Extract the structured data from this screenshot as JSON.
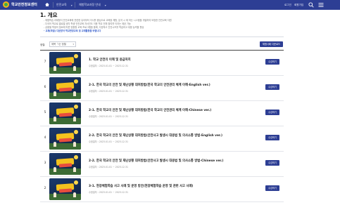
{
  "header": {
    "logo_text": "학교안전정보센터",
    "nav_1": "안전교육",
    "nav_2": "체험학교과정 안내",
    "util_1": "로그인",
    "util_2": "회원가입",
    "brand_color": "#2d3e94"
  },
  "page": {
    "title": "1. 개요",
    "intro": [
      "체험학습 과제형이 안전교육에 관련한 유아부터 이사를 중심으로 교육을 체험, 분석 시 제 하는 시스템을 개발하여 보완한 안전교육 자원",
      "다국어 학교로 클로벌 생각 학생 안전교육 자서인도 이용 학교 전체 참여를 이라는 제공 가능",
      "상황별 학생의 필요에 따른 맞춤형 교육 프로그램을 통해, 다양하고 안전시즈를 학습하고 대응 능력을 향상",
      "교재(파일) 다운받아 학교현장교육 및 교재활용을 바랍니다"
    ]
  },
  "controls": {
    "sort_label": "정렬",
    "sort_value": "제목 ㄱ순 정렬",
    "download_all": "체험사례 다운로드"
  },
  "rows": [
    {
      "num": "7",
      "title": "1. 학교 안전의 이해 및 응급처치",
      "date": "수정일자 : 2023.01.01 ~ 2023.12.31",
      "button": "수강하기"
    },
    {
      "num": "6",
      "title": "2-1. 한국 학교의 안전 및 재난상황 대처방법(한국 학교의 안전관리 체계 이해-English ver.)",
      "date": "수정일자 : 2023.01.01 ~ 2023.12.31",
      "button": "수강하기"
    },
    {
      "num": "5",
      "title": "2-1. 한국 학교의 안전 및 재난상황 대처방법(한국 학교의 안전관리 체계 이해-Chinese ver.)",
      "date": "수정일자 : 2023.01.01 ~ 2023.12.31",
      "button": "수강하기"
    },
    {
      "num": "4",
      "title": "2-2. 한국 학교의 안전 및 재난상황 대처방법(안전사고 발생시 대응법 및 의사소통 방법-English ver.)",
      "date": "수정일자 : 2023.01.01 ~ 2023.12.31",
      "button": "수강하기"
    },
    {
      "num": "3",
      "title": "2-2. 한국 학교의 안전 및 재난상황 대처방법(안전사고 발생시 대응법 및 의사소통 방법-Chinese ver.)",
      "date": "수정일자 : 2023.01.01 ~ 2023.12.31",
      "button": "수강하기"
    },
    {
      "num": "2",
      "title": "3-1. 현장체험학습 사고 사례 및 운영 방안(현장체험학습 운영 및 관련 사고 사례)",
      "date": "수정일자 : 2023.01.01 ~ 2023.12.31",
      "button": "수강하기"
    }
  ]
}
